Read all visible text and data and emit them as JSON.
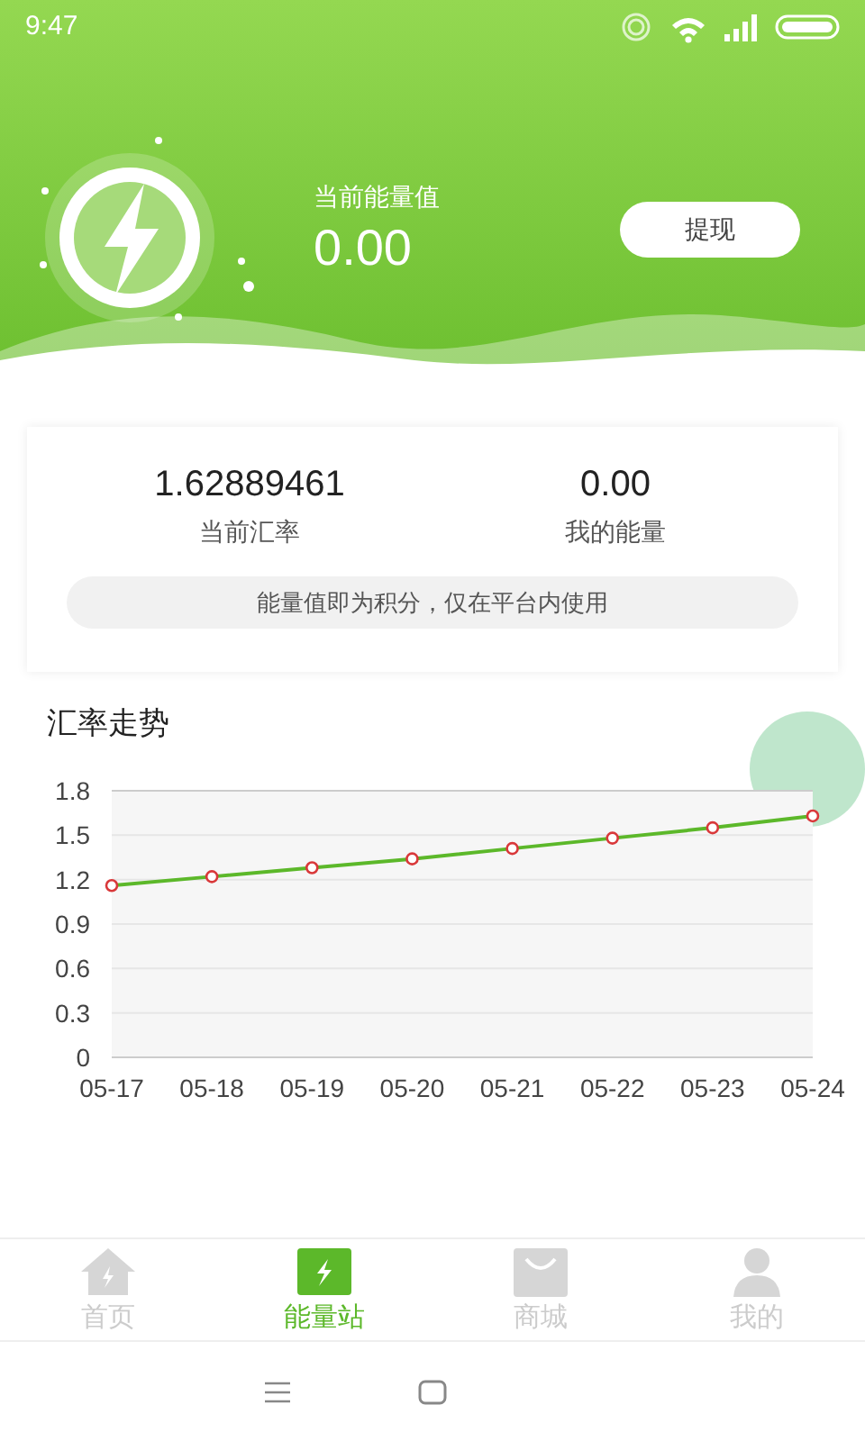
{
  "status_bar": {
    "time": "9:47"
  },
  "header": {
    "label": "当前能量值",
    "value": "0.00",
    "button": "提现"
  },
  "summary": {
    "stats": [
      {
        "value": "1.62889461",
        "label": "当前汇率"
      },
      {
        "value": "0.00",
        "label": "我的能量"
      }
    ],
    "note": "能量值即为积分，仅在平台内使用"
  },
  "chart_section": {
    "title": "汇率走势",
    "chart_data": {
      "type": "line",
      "categories": [
        "05-17",
        "05-18",
        "05-19",
        "05-20",
        "05-21",
        "05-22",
        "05-23",
        "05-24"
      ],
      "ylim": [
        0,
        1.8
      ],
      "yticks": [
        0,
        0.3,
        0.6,
        0.9,
        1.2,
        1.5,
        1.8
      ],
      "grid": true,
      "series": [
        {
          "color": "#5cb82a",
          "marker": "circle",
          "values": [
            1.16,
            1.22,
            1.28,
            1.34,
            1.41,
            1.48,
            1.55,
            1.63
          ]
        }
      ]
    }
  },
  "tab_bar": [
    {
      "kind": "home",
      "label": "首页",
      "selected": false
    },
    {
      "kind": "energy",
      "label": "能量站",
      "selected": true
    },
    {
      "kind": "shop",
      "label": "商城",
      "selected": false
    },
    {
      "kind": "profile",
      "label": "我的",
      "selected": false
    }
  ]
}
